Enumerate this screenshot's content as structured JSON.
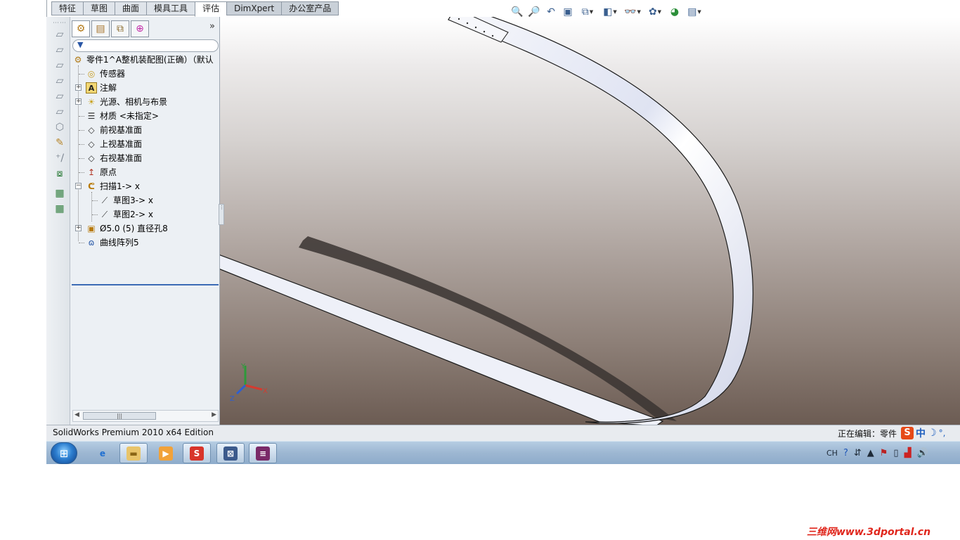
{
  "tabs": [
    {
      "label": "特征",
      "active": false
    },
    {
      "label": "草图",
      "active": false
    },
    {
      "label": "曲面",
      "active": false
    },
    {
      "label": "模具工具",
      "active": false
    },
    {
      "label": "评估",
      "active": true
    },
    {
      "label": "DimXpert",
      "active": false
    },
    {
      "label": "办公室产品",
      "active": false
    }
  ],
  "hud_icons": [
    "zoom-to-fit-icon",
    "zoom-to-area-icon",
    "previous-view-icon",
    "section-view-icon",
    "view-orientation-icon",
    "display-style-icon",
    "hide-show-items-icon",
    "edit-appearance-icon",
    "apply-scene-icon",
    "view-settings-icon"
  ],
  "feature_tree": {
    "filter_placeholder": "",
    "more_glyph": "»",
    "root": "零件1^A整机装配图(正确）（默认",
    "items": [
      {
        "label": "传感器",
        "icon": "sensor-icon"
      },
      {
        "label": "注解",
        "icon": "annotations-icon",
        "expandable": true
      },
      {
        "label": "光源、相机与布景",
        "icon": "lights-cameras-icon",
        "expandable": true
      },
      {
        "label": "材质 <未指定>",
        "icon": "material-icon"
      },
      {
        "label": "前视基准面",
        "icon": "plane-icon"
      },
      {
        "label": "上视基准面",
        "icon": "plane-icon"
      },
      {
        "label": "右视基准面",
        "icon": "plane-icon"
      },
      {
        "label": "原点",
        "icon": "origin-icon"
      },
      {
        "label": "扫描1-> x",
        "icon": "sweep-icon",
        "expanded": true
      },
      {
        "label": "草图3-> x",
        "icon": "sketch-icon",
        "child": true
      },
      {
        "label": "草图2-> x",
        "icon": "sketch-icon",
        "child": true
      },
      {
        "label": "Ø5.0 (5) 直径孔8",
        "icon": "hole-wizard-icon",
        "expandable": true
      },
      {
        "label": "曲线阵列5",
        "icon": "curve-pattern-icon"
      }
    ]
  },
  "triad": {
    "x": "X",
    "y": "Y",
    "z": "Z"
  },
  "status": {
    "left": "SolidWorks Premium 2010 x64 Edition",
    "right": "正在编辑：零件"
  },
  "ime": {
    "logo": "S",
    "lang": "中",
    "moon": "☽",
    "dots": "°,"
  },
  "tray": {
    "lang": "CH"
  },
  "watermark": "三维网www.3dportal.cn",
  "colors": {
    "accent": "#3b6bb5",
    "band": "#f2f4fa",
    "band_edge": "#1a1a1a",
    "watermark": "#e0261c"
  }
}
